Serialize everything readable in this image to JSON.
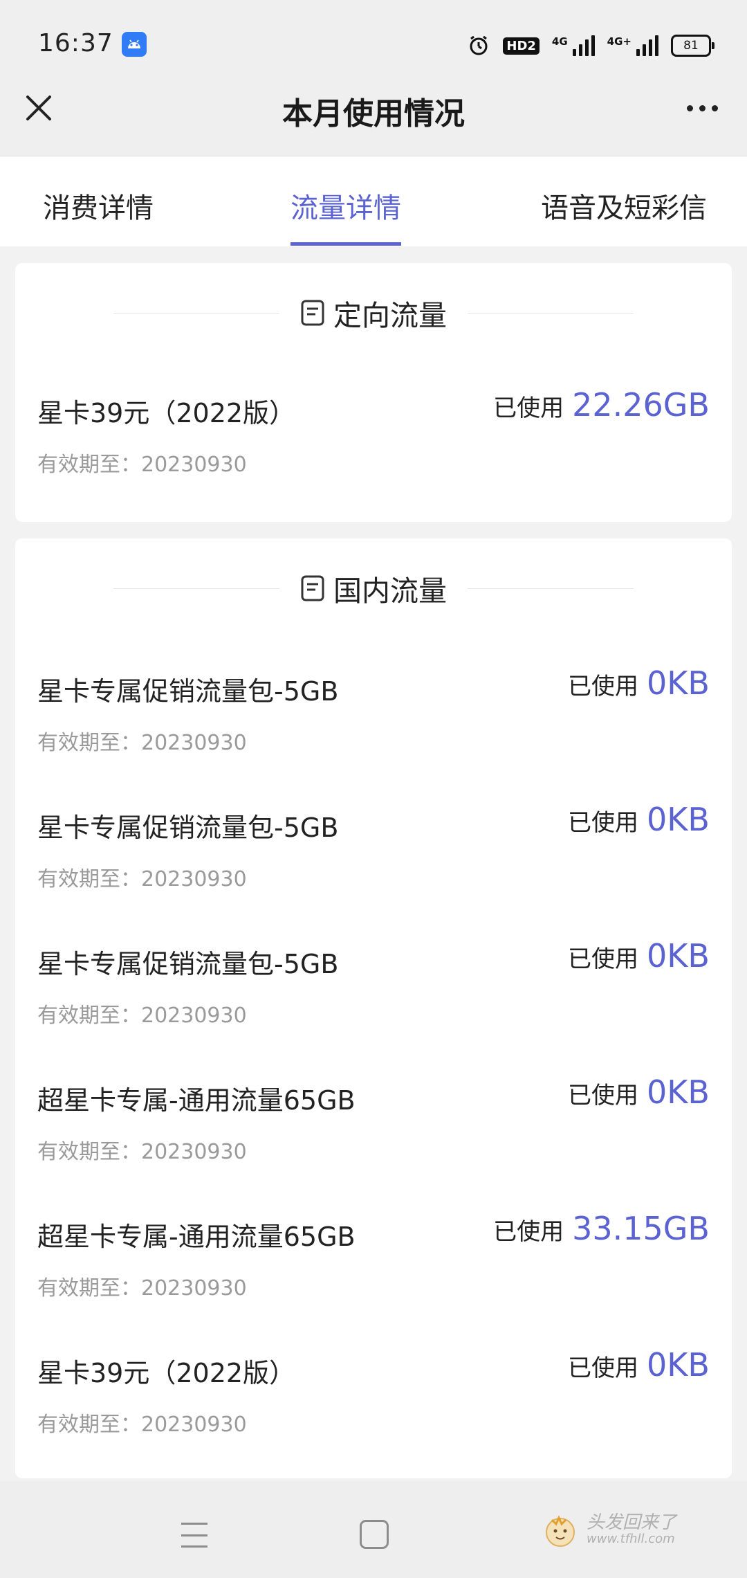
{
  "status": {
    "time": "16:37",
    "hd_label": "HD2",
    "signal1_label": "4G",
    "signal2_label": "4G+",
    "battery": "81"
  },
  "header": {
    "title": "本月使用情况"
  },
  "tabs": [
    {
      "label": "消费详情",
      "active": false
    },
    {
      "label": "流量详情",
      "active": true
    },
    {
      "label": "语音及短彩信",
      "active": false
    }
  ],
  "sections": [
    {
      "title": "定向流量",
      "items": [
        {
          "name": "星卡39元（2022版）",
          "used_label": "已使用",
          "used_value": "22.26GB",
          "valid": "有效期至：20230930"
        }
      ]
    },
    {
      "title": "国内流量",
      "items": [
        {
          "name": "星卡专属促销流量包-5GB",
          "used_label": "已使用",
          "used_value": "0KB",
          "valid": "有效期至：20230930"
        },
        {
          "name": "星卡专属促销流量包-5GB",
          "used_label": "已使用",
          "used_value": "0KB",
          "valid": "有效期至：20230930"
        },
        {
          "name": "星卡专属促销流量包-5GB",
          "used_label": "已使用",
          "used_value": "0KB",
          "valid": "有效期至：20230930"
        },
        {
          "name": "超星卡专属-通用流量65GB",
          "used_label": "已使用",
          "used_value": "0KB",
          "valid": "有效期至：20230930"
        },
        {
          "name": "超星卡专属-通用流量65GB",
          "used_label": "已使用",
          "used_value": "33.15GB",
          "valid": "有效期至：20230930"
        },
        {
          "name": "星卡39元（2022版）",
          "used_label": "已使用",
          "used_value": "0KB",
          "valid": "有效期至：20230930"
        }
      ]
    }
  ],
  "watermark": {
    "line1": "头发回来了",
    "line2": "www.tfhll.com"
  },
  "colors": {
    "accent": "#5b62d2",
    "muted": "#9a9a9a"
  }
}
